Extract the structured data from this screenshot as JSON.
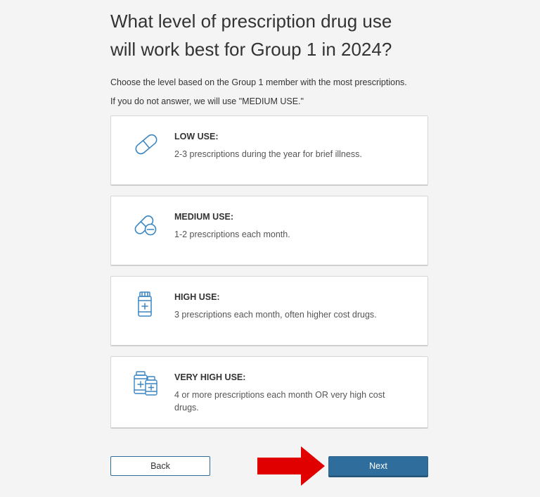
{
  "page": {
    "title_line1": "What level of prescription drug use",
    "title_line2": "will work best for Group 1 in 2024?",
    "instruction": "Choose the level based on the Group 1 member with the most prescriptions.",
    "default_note": "If you do not answer, we will use \"MEDIUM USE.\""
  },
  "options": [
    {
      "label": "LOW USE:",
      "description": "2-3 prescriptions during the year for brief illness.",
      "icon": "capsule-icon"
    },
    {
      "label": "MEDIUM USE:",
      "description": "1-2 prescriptions each month.",
      "icon": "capsule-pill-icon"
    },
    {
      "label": "HIGH USE:",
      "description": "3 prescriptions each month, often higher cost drugs.",
      "icon": "pill-bottle-icon"
    },
    {
      "label": "VERY HIGH USE:",
      "description": "4 or more prescriptions each month OR very high cost drugs.",
      "icon": "two-pill-bottles-icon"
    }
  ],
  "buttons": {
    "back": "Back",
    "next": "Next"
  },
  "colors": {
    "accent": "#2f6e9c",
    "icon": "#3a86c3",
    "arrow": "#e00000",
    "background": "#f4f4f4"
  }
}
